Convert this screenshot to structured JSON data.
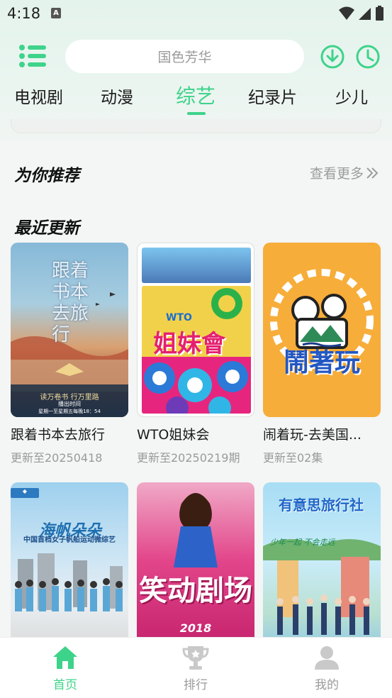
{
  "status": {
    "time": "4:18",
    "notif_icon": "A"
  },
  "header": {
    "search_placeholder": "国色芳华",
    "menu_icon": "list-icon",
    "download_icon": "download-icon",
    "history_icon": "clock-icon"
  },
  "tabs": [
    {
      "label": "电视剧"
    },
    {
      "label": "动漫"
    },
    {
      "label": "综艺",
      "active": true
    },
    {
      "label": "纪录片"
    },
    {
      "label": "少儿"
    }
  ],
  "recommend": {
    "title": "为你推荐",
    "more": "查看更多"
  },
  "recent": {
    "title": "最近更新",
    "items": [
      {
        "title": "跟着书本去旅行",
        "sub": "更新至20250418",
        "poster_text": "跟着书本去旅行",
        "poster_caption": "读万卷书 行万里路",
        "poster_caption2": "播出时间",
        "poster_caption3": "星期一至星期五每晚18：54"
      },
      {
        "title": "WTO姐妹会",
        "sub": "更新至20250219期",
        "poster_text": "姐妹會",
        "poster_wto": "WTO"
      },
      {
        "title": "闹着玩-去美国...",
        "sub": "更新至02集",
        "poster_text": "鬧著玩"
      },
      {
        "title": "",
        "sub": "",
        "poster_text": "海帆朵朵",
        "poster_caption": "中国首档女子帆船运动微综艺"
      },
      {
        "title": "",
        "sub": "",
        "poster_text": "笑动剧场",
        "poster_year": "2018"
      },
      {
        "title": "",
        "sub": "",
        "poster_text": "有意思旅行社",
        "poster_caption": "少年一起 不会走远"
      }
    ]
  },
  "bottom_nav": [
    {
      "label": "首页",
      "active": true
    },
    {
      "label": "排行"
    },
    {
      "label": "我的"
    }
  ],
  "colors": {
    "accent": "#3ed38a",
    "inactive": "#9a9a9a"
  }
}
